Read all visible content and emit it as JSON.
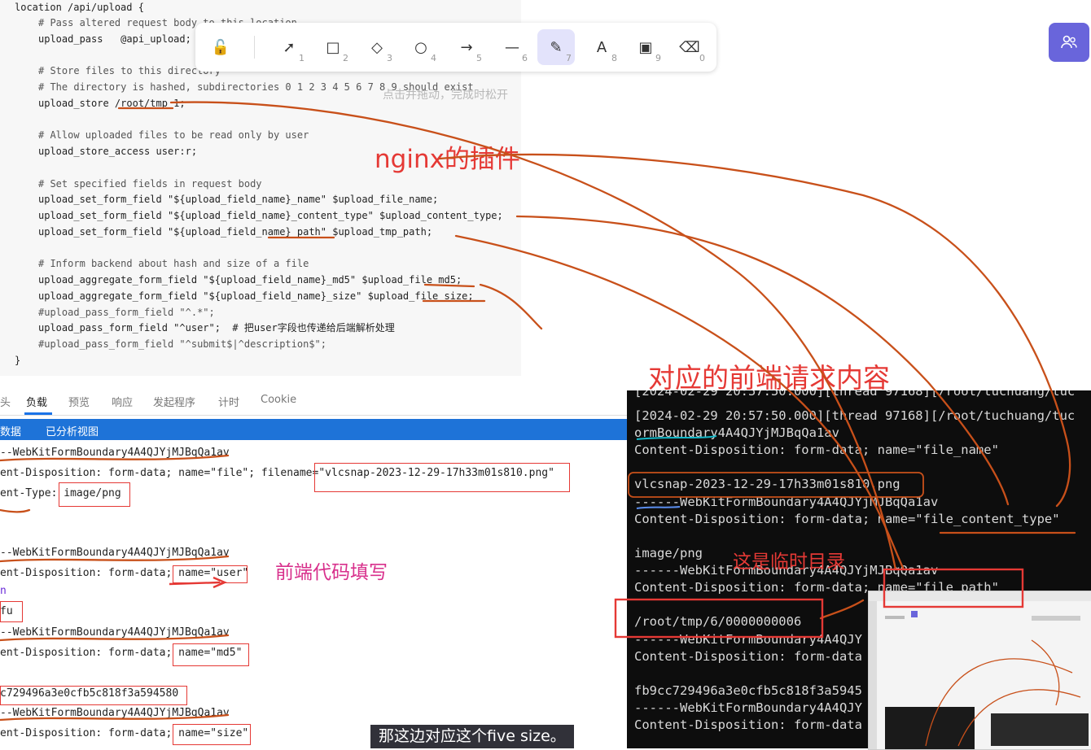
{
  "code": {
    "first_line": "location /api/upload {",
    "lines": [
      {
        "text": "# Pass altered request body to this location",
        "comment": true
      },
      {
        "text": "upload_pass   @api_upload;",
        "comment": false
      },
      {
        "text": "",
        "comment": false
      },
      {
        "text": "# Store files to this directory",
        "comment": true
      },
      {
        "text": "# The directory is hashed, subdirectories 0 1 2 3 4 5 6 7 8 9 should exist",
        "comment": true
      },
      {
        "text": "upload_store /root/tmp 1;",
        "comment": false
      },
      {
        "text": "",
        "comment": false
      },
      {
        "text": "# Allow uploaded files to be read only by user",
        "comment": true
      },
      {
        "text": "upload_store_access user:r;",
        "comment": false
      },
      {
        "text": "",
        "comment": false
      },
      {
        "text": "# Set specified fields in request body",
        "comment": true
      },
      {
        "text": "upload_set_form_field \"${upload_field_name}_name\" $upload_file_name;",
        "comment": false
      },
      {
        "text": "upload_set_form_field \"${upload_field_name}_content_type\" $upload_content_type;",
        "comment": false
      },
      {
        "text": "upload_set_form_field \"${upload_field_name}_path\" $upload_tmp_path;",
        "comment": false
      },
      {
        "text": "",
        "comment": false
      },
      {
        "text": "# Inform backend about hash and size of a file",
        "comment": true
      },
      {
        "text": "upload_aggregate_form_field \"${upload_field_name}_md5\" $upload_file_md5;",
        "comment": false
      },
      {
        "text": "upload_aggregate_form_field \"${upload_field_name}_size\" $upload_file_size;",
        "comment": false
      },
      {
        "text": "#upload_pass_form_field \"^.*\";",
        "comment": true
      },
      {
        "text": "upload_pass_form_field \"^user\";  # 把user字段也传递给后端解析处理",
        "comment": false
      },
      {
        "text": "#upload_pass_form_field \"^submit$|^description$\";",
        "comment": true
      }
    ],
    "close_line": "}"
  },
  "toolbar": {
    "tools": [
      {
        "name": "lock-icon",
        "glyph": "🔓",
        "num": ""
      },
      {
        "name": "selection-tool-icon",
        "glyph": "➚",
        "num": "1"
      },
      {
        "name": "rectangle-tool-icon",
        "glyph": "□",
        "num": "2"
      },
      {
        "name": "diamond-tool-icon",
        "glyph": "◇",
        "num": "3"
      },
      {
        "name": "ellipse-tool-icon",
        "glyph": "○",
        "num": "4"
      },
      {
        "name": "arrow-tool-icon",
        "glyph": "→",
        "num": "5"
      },
      {
        "name": "line-tool-icon",
        "glyph": "—",
        "num": "6"
      },
      {
        "name": "pencil-tool-icon",
        "glyph": "✎",
        "num": "7"
      },
      {
        "name": "text-tool-icon",
        "glyph": "A",
        "num": "8"
      },
      {
        "name": "image-tool-icon",
        "glyph": "▣",
        "num": "9"
      },
      {
        "name": "eraser-tool-icon",
        "glyph": "⌫",
        "num": "0"
      }
    ],
    "active_tool": "pencil-tool-icon"
  },
  "hint": "点击并拖动，完成时松开",
  "annotations": {
    "nginx_plugin": "nginx的插件",
    "frontend_content": "对应的前端请求内容",
    "frontend_code": "前端代码填写",
    "temp_dir": "这是临时目录"
  },
  "devtools": {
    "tabs": [
      "头",
      "负载",
      "预览",
      "响应",
      "发起程序",
      "计时",
      "Cookie"
    ],
    "active_tab": "负载",
    "subtabs": [
      "数据",
      "已分析视图"
    ],
    "lines": [
      "--WebKitFormBoundary4A4QJYjMJBqQa1av",
      "ent-Disposition: form-data; name=\"file\"; filename=\"vlcsnap-2023-12-29-17h33m01s810.png\"",
      "ent-Type: image/png",
      "",
      "",
      "--WebKitFormBoundary4A4QJYjMJBqQa1av",
      "ent-Disposition: form-data; name=\"user\"",
      "n",
      "fu",
      "--WebKitFormBoundary4A4QJYjMJBqQa1av",
      "ent-Disposition: form-data; name=\"md5\"",
      "",
      "c729496a3e0cfb5c818f3a594580",
      "--WebKitFormBoundary4A4QJYjMJBqQa1av",
      "ent-Disposition: form-data; name=\"size\""
    ]
  },
  "terminal": {
    "lines": [
      "[2024-02-29 20:57:50.000][thread 97168][/root/tuchuang/tuc",
      "[2024-02-29 20:57:50.000][thread 97168][/root/tuchuang/tuc",
      "ormBoundary4A4QJYjMJBqQa1av",
      "Content-Disposition: form-data; name=\"file_name\"",
      "",
      "vlcsnap-2023-12-29-17h33m01s810.png",
      "------WebKitFormBoundary4A4QJYjMJBqQa1av",
      "Content-Disposition: form-data; name=\"file_content_type\"",
      "",
      "image/png",
      "------WebKitFormBoundary4A4QJYjMJBqQa1av",
      "Content-Disposition: form-data; name=\"file_path\"",
      "",
      "/root/tmp/6/0000000006",
      "------WebKitFormBoundary4A4QJY",
      "Content-Disposition: form-data",
      "",
      "fb9cc729496a3e0cfb5c818f3a5945",
      "------WebKitFormBoundary4A4QJY",
      "Content-Disposition: form-data"
    ]
  },
  "subtitle": "那这边对应这个five size。",
  "colors": {
    "accent": "#6965db",
    "annotation_red": "#e53935",
    "stroke_orange": "#c8501a",
    "devtools_blue": "#1e73d8",
    "terminal_bg": "#0d0d0d"
  }
}
